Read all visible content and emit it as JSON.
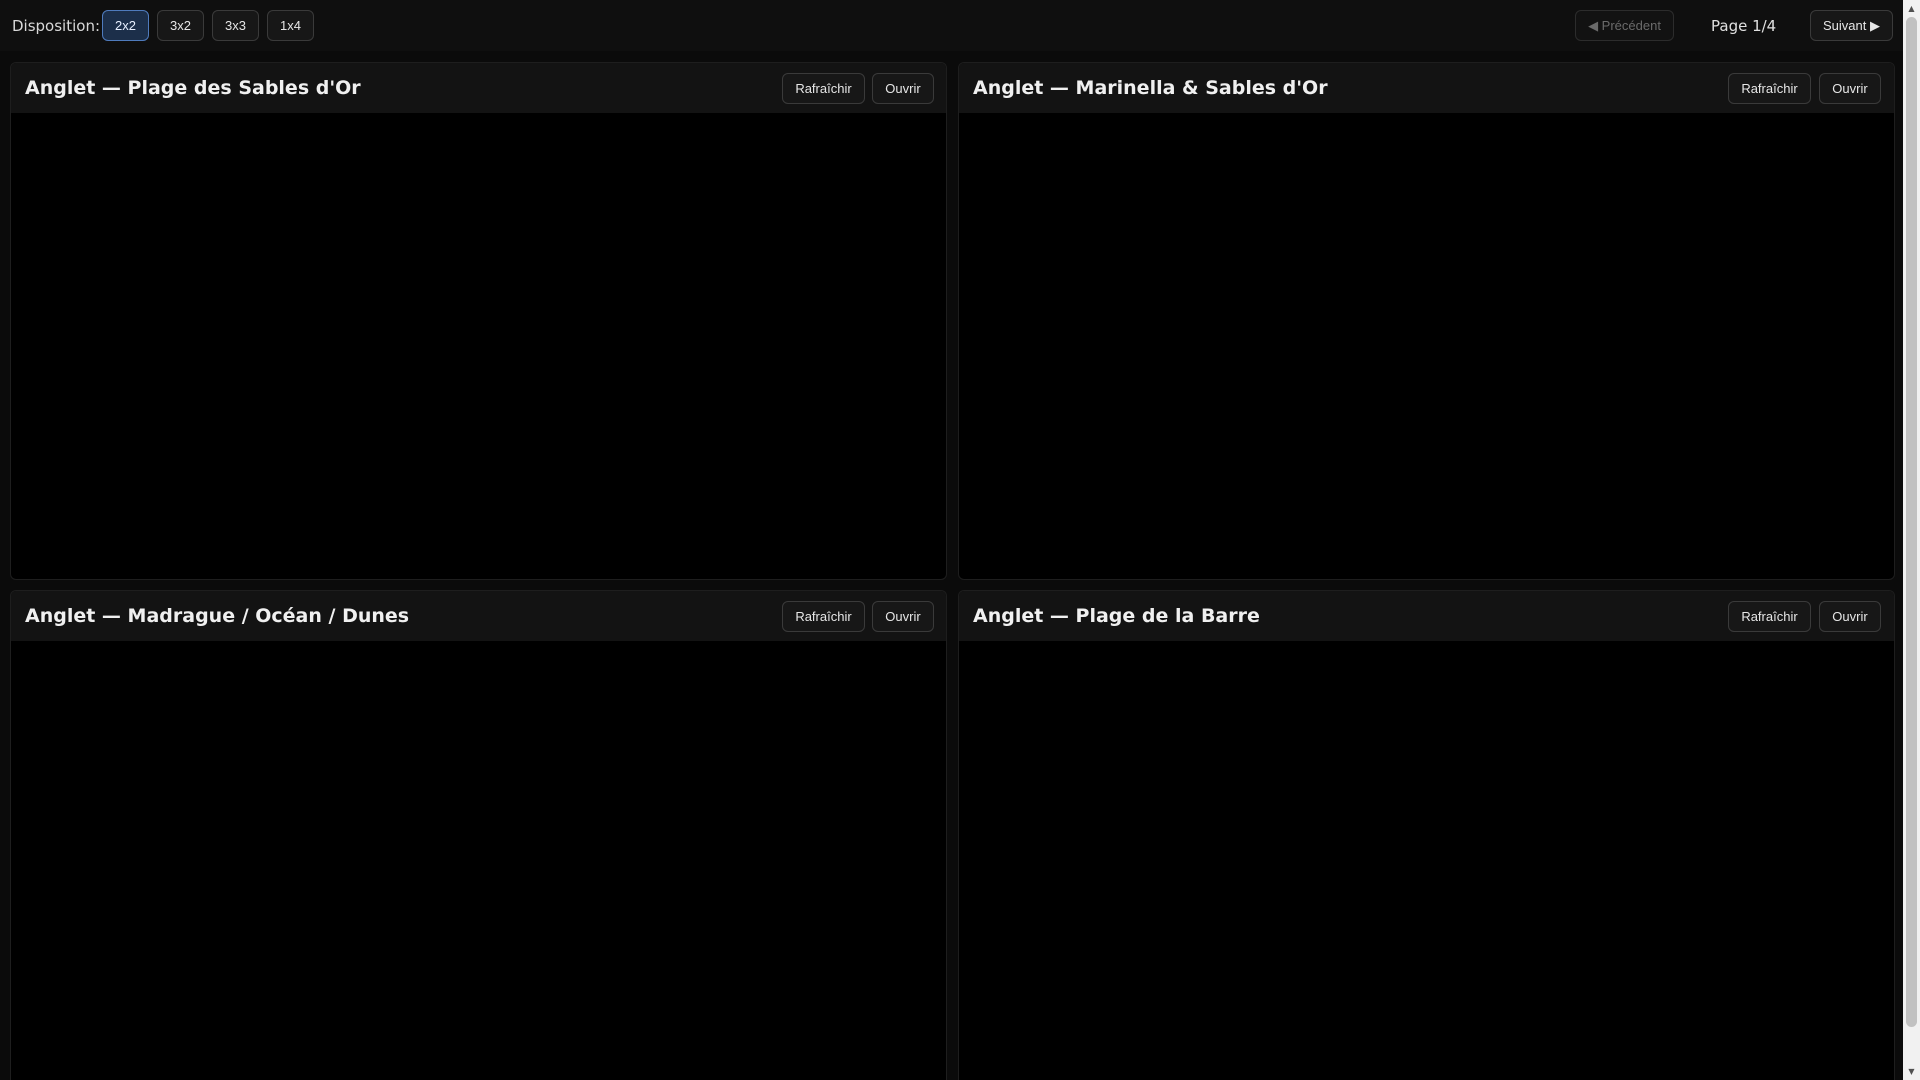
{
  "toolbar": {
    "layout_label": "Disposition:",
    "layouts": [
      {
        "label": "2x2",
        "active": true
      },
      {
        "label": "3x2",
        "active": false
      },
      {
        "label": "3x3",
        "active": false
      },
      {
        "label": "1x4",
        "active": false
      }
    ],
    "prev_label": "◀ Précédent",
    "page_info": "Page 1/4",
    "next_label": "Suivant ▶"
  },
  "panels": [
    {
      "title": "Anglet — Plage des Sables d'Or",
      "refresh_label": "Rafraîchir",
      "open_label": "Ouvrir"
    },
    {
      "title": "Anglet — Marinella & Sables d'Or",
      "refresh_label": "Rafraîchir",
      "open_label": "Ouvrir"
    },
    {
      "title": "Anglet — Madrague / Océan / Dunes",
      "refresh_label": "Rafraîchir",
      "open_label": "Ouvrir"
    },
    {
      "title": "Anglet — Plage de la Barre",
      "refresh_label": "Rafraîchir",
      "open_label": "Ouvrir"
    }
  ],
  "colors": {
    "background": "#0b0b0b",
    "active_accent": "#4f7bbd"
  }
}
